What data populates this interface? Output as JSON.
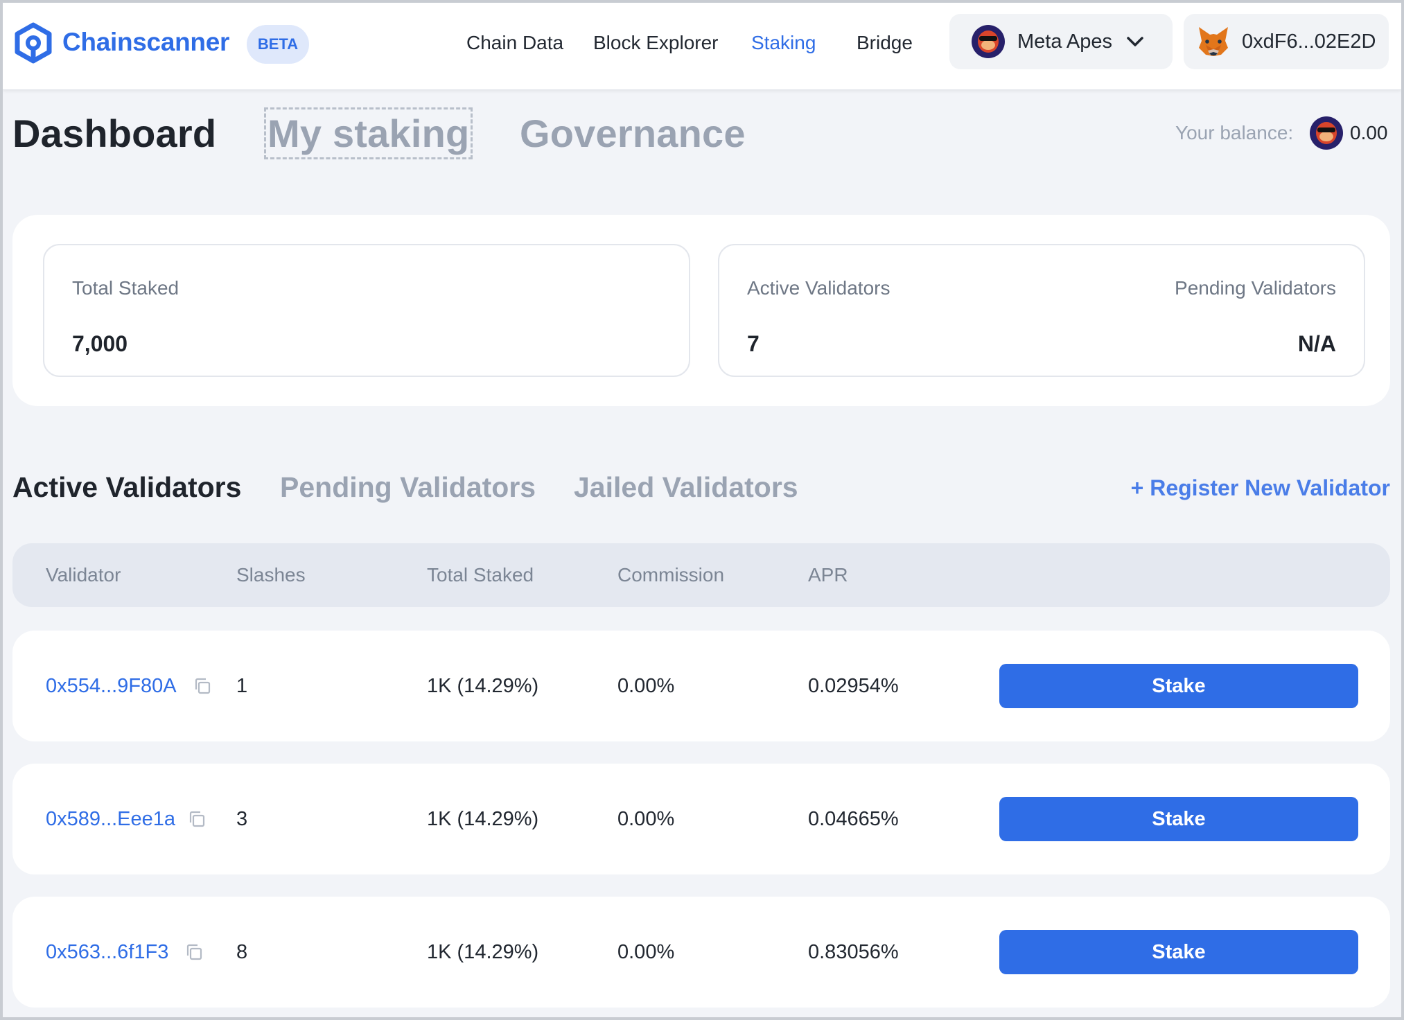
{
  "brand": {
    "name": "Chainscanner",
    "badge": "BETA"
  },
  "nav": {
    "links": [
      {
        "label": "Chain Data"
      },
      {
        "label": "Block Explorer"
      },
      {
        "label": "Staking",
        "active": true
      },
      {
        "label": "Bridge"
      }
    ],
    "network": {
      "label": "Meta Apes",
      "icon": "meta-apes-icon"
    },
    "wallet": {
      "address": "0xdF6...02E2D",
      "icon": "metamask-fox-icon"
    }
  },
  "page_tabs": [
    {
      "label": "Dashboard",
      "active": true
    },
    {
      "label": "My staking",
      "focused": true
    },
    {
      "label": "Governance"
    }
  ],
  "balance": {
    "label": "Your balance:",
    "value": "0.00"
  },
  "stats": {
    "total_staked": {
      "label": "Total Staked",
      "value": "7,000"
    },
    "active_validators": {
      "label": "Active Validators",
      "value": "7"
    },
    "pending_validators": {
      "label": "Pending Validators",
      "value": "N/A"
    }
  },
  "validator_tabs": [
    {
      "label": "Active Validators",
      "active": true
    },
    {
      "label": "Pending Validators"
    },
    {
      "label": "Jailed Validators"
    }
  ],
  "register_label": "+ Register New Validator",
  "table": {
    "headers": [
      "Validator",
      "Slashes",
      "Total Staked",
      "Commission",
      "APR"
    ],
    "rows": [
      {
        "validator": "0x554...9F80A",
        "slashes": "1",
        "total_staked": "1K (14.29%)",
        "commission": "0.00%",
        "apr": "0.02954%",
        "action": "Stake"
      },
      {
        "validator": "0x589...Eee1a",
        "slashes": "3",
        "total_staked": "1K (14.29%)",
        "commission": "0.00%",
        "apr": "0.04665%",
        "action": "Stake"
      },
      {
        "validator": "0x563...6f1F3",
        "slashes": "8",
        "total_staked": "1K (14.29%)",
        "commission": "0.00%",
        "apr": "0.83056%",
        "action": "Stake"
      }
    ]
  },
  "colors": {
    "accent": "#2f6de6",
    "muted": "#9aa3b2",
    "background": "#f2f4f8"
  }
}
